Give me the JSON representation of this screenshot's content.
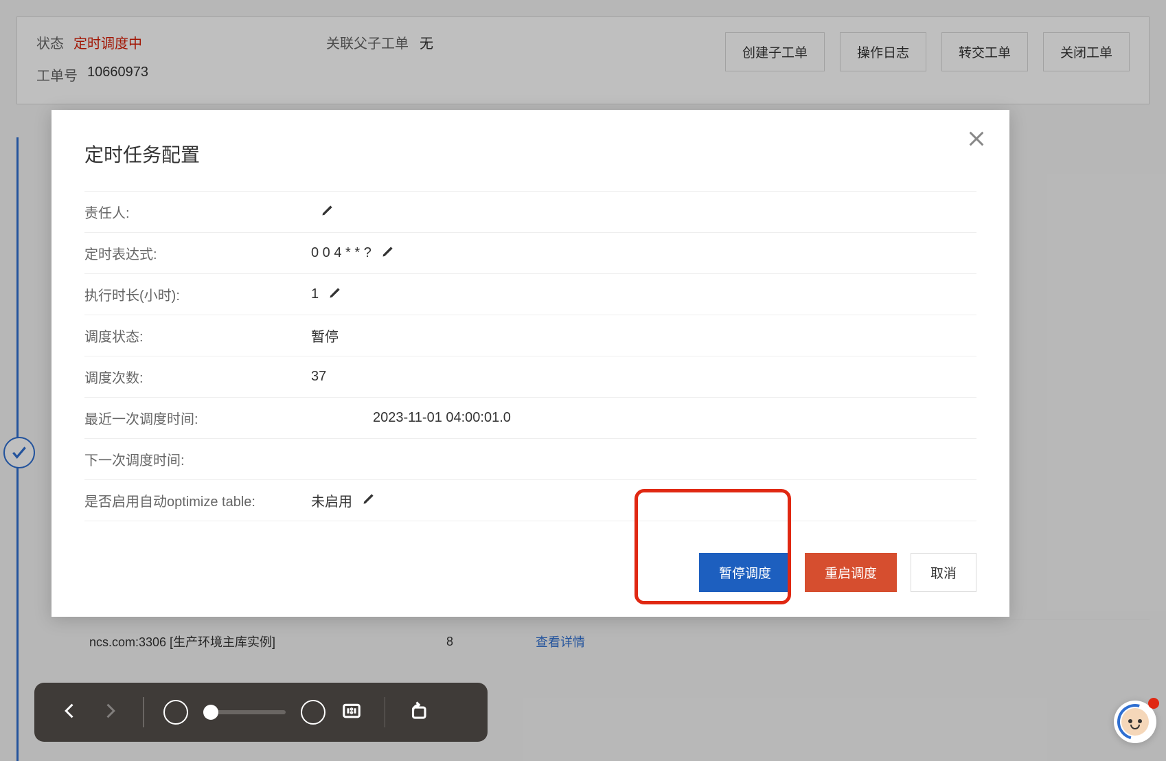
{
  "header": {
    "status_label": "状态",
    "status_value": "定时调度中",
    "ticket_label": "工单号",
    "ticket_value": "10660973",
    "relation_label": "关联父子工单",
    "relation_value": "无",
    "buttons": {
      "create_sub": "创建子工单",
      "op_log": "操作日志",
      "transfer": "转交工单",
      "close": "关闭工单"
    }
  },
  "modal": {
    "title": "定时任务配置",
    "labels": {
      "owner": "责任人:",
      "cron": "定时表达式:",
      "duration": "执行时长(小时):",
      "sched_status": "调度状态:",
      "sched_count": "调度次数:",
      "last_time": "最近一次调度时间:",
      "next_time": "下一次调度时间:",
      "auto_optimize": "是否启用自动optimize table:"
    },
    "values": {
      "owner": "",
      "cron": "0 0 4 * * ?",
      "duration": "1",
      "sched_status": "暂停",
      "sched_count": "37",
      "last_time": "2023-11-01 04:00:01.0",
      "next_time": "",
      "auto_optimize": "未启用"
    },
    "buttons": {
      "pause": "暂停调度",
      "restart": "重启调度",
      "cancel": "取消"
    }
  },
  "bg_row": {
    "host_suffix": "ncs.com:3306 [生产环境主库实例]",
    "count": "8",
    "link": "查看详情"
  },
  "icons": {
    "close": "close-icon",
    "edit": "pencil-icon",
    "check": "check-circle-icon"
  }
}
